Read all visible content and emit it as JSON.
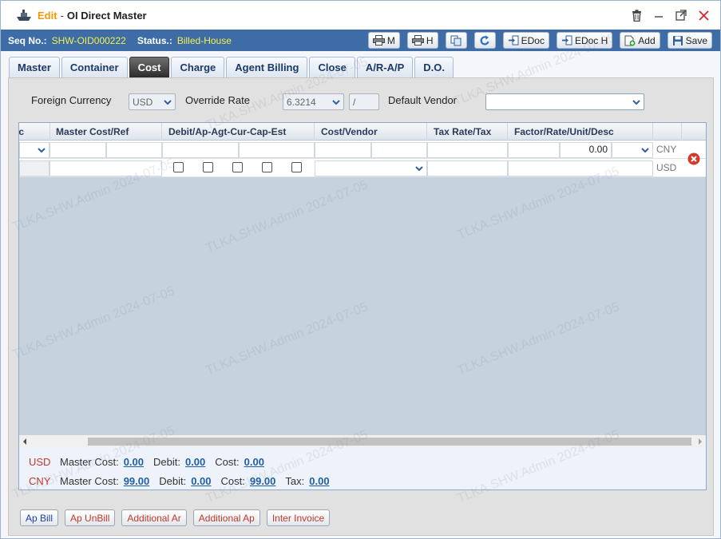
{
  "window": {
    "mode": "Edit",
    "separator": "-",
    "title": "OI Direct Master"
  },
  "status": {
    "seq_label": "Seq No.:",
    "seq_value": "SHW-OID000222",
    "status_label": "Status.:",
    "status_value": "Billed-House"
  },
  "toolbar": {
    "print_m": "M",
    "print_h": "H",
    "edoc": "EDoc",
    "edoc_h": "EDoc H",
    "add": "Add",
    "save": "Save"
  },
  "tabs": [
    {
      "label": "Master"
    },
    {
      "label": "Container"
    },
    {
      "label": "Cost",
      "active": true
    },
    {
      "label": "Charge"
    },
    {
      "label": "Agent Billing"
    },
    {
      "label": "Close"
    },
    {
      "label": "A/R-A/P"
    },
    {
      "label": "D.O."
    }
  ],
  "filters": {
    "foreign_currency_label": "Foreign Currency",
    "foreign_currency_value": "USD",
    "override_rate_label": "Override Rate",
    "override_rate_value": "6.3214",
    "override_rate_slash": "/",
    "default_vendor_label": "Default Vendor",
    "default_vendor_value": ""
  },
  "grid": {
    "columns": [
      "c",
      "Master Cost/Ref",
      "Debit/Ap-Agt-Cur-Cap-Est",
      "Cost/Vendor",
      "Tax Rate/Tax",
      "Factor/Rate/Unit/Desc"
    ],
    "row1": {
      "amount": "0.00",
      "currency": "CNY"
    },
    "row2": {
      "currency": "USD"
    }
  },
  "totals": {
    "usd": {
      "currency": "USD",
      "master_cost_label": "Master Cost:",
      "master_cost": "0.00",
      "debit_label": "Debit:",
      "debit": "0.00",
      "cost_label": "Cost:",
      "cost": "0.00"
    },
    "cny": {
      "currency": "CNY",
      "master_cost_label": "Master Cost:",
      "master_cost": "99.00",
      "debit_label": "Debit:",
      "debit": "0.00",
      "cost_label": "Cost:",
      "cost": "99.00",
      "tax_label": "Tax:",
      "tax": "0.00"
    }
  },
  "bottom_buttons": [
    {
      "label": "Ap Bill",
      "color": "#1f3fa8"
    },
    {
      "label": "Ap UnBill",
      "color": "#c0392b"
    },
    {
      "label": "Additional Ar",
      "color": "#c0392b"
    },
    {
      "label": "Additional Ap",
      "color": "#c0392b"
    },
    {
      "label": "Inter Invoice",
      "color": "#c0392b"
    }
  ],
  "watermark": "TLKA.SHW.Admin 2024-07-05",
  "colors": {
    "status_bar": "#3e6ca6",
    "status_value": "#f5f04a",
    "edit_accent": "#f39800",
    "grid_body": "#c6d2de",
    "link": "#1f5fa5"
  }
}
